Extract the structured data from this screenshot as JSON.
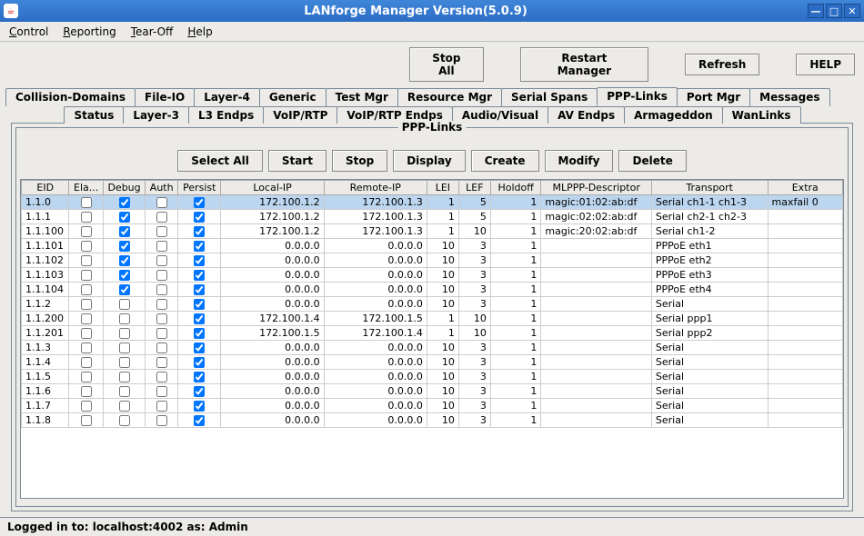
{
  "window": {
    "title": "LANforge Manager    Version(5.0.9)",
    "java_icon": "☕"
  },
  "menubar": [
    "Control",
    "Reporting",
    "Tear-Off",
    "Help"
  ],
  "toolbar": {
    "stop_all": "Stop All",
    "restart": "Restart Manager",
    "refresh": "Refresh",
    "help": "HELP"
  },
  "tabs_row1": [
    "Collision-Domains",
    "File-IO",
    "Layer-4",
    "Generic",
    "Test Mgr",
    "Resource Mgr",
    "Serial Spans",
    "PPP-Links",
    "Port Mgr",
    "Messages"
  ],
  "tabs_row2": [
    "Status",
    "Layer-3",
    "L3 Endps",
    "VoIP/RTP",
    "VoIP/RTP Endps",
    "Audio/Visual",
    "AV Endps",
    "Armageddon",
    "WanLinks"
  ],
  "active_tab": "PPP-Links",
  "panel": {
    "legend": "PPP-Links",
    "actions": {
      "select_all": "Select All",
      "start": "Start",
      "stop": "Stop",
      "display": "Display",
      "create": "Create",
      "modify": "Modify",
      "delete": "Delete"
    },
    "columns": [
      "EID",
      "Ela...",
      "Debug",
      "Auth",
      "Persist",
      "Local-IP",
      "Remote-IP",
      "LEI",
      "LEF",
      "Holdoff",
      "MLPPP-Descriptor",
      "Transport",
      "Extra"
    ],
    "rows": [
      {
        "eid": "1.1.0",
        "ela": false,
        "debug": true,
        "auth": false,
        "persist": true,
        "local": "172.100.1.2",
        "remote": "172.100.1.3",
        "lei": "1",
        "lef": "5",
        "hold": "1",
        "mlppp": "magic:01:02:ab:df",
        "trans": "Serial ch1-1 ch1-3",
        "extra": "maxfail 0",
        "selected": true
      },
      {
        "eid": "1.1.1",
        "ela": false,
        "debug": true,
        "auth": false,
        "persist": true,
        "local": "172.100.1.2",
        "remote": "172.100.1.3",
        "lei": "1",
        "lef": "5",
        "hold": "1",
        "mlppp": "magic:02:02:ab:df",
        "trans": "Serial ch2-1 ch2-3",
        "extra": ""
      },
      {
        "eid": "1.1.100",
        "ela": false,
        "debug": true,
        "auth": false,
        "persist": true,
        "local": "172.100.1.2",
        "remote": "172.100.1.3",
        "lei": "1",
        "lef": "10",
        "hold": "1",
        "mlppp": "magic:20:02:ab:df",
        "trans": "Serial ch1-2",
        "extra": ""
      },
      {
        "eid": "1.1.101",
        "ela": false,
        "debug": true,
        "auth": false,
        "persist": true,
        "local": "0.0.0.0",
        "remote": "0.0.0.0",
        "lei": "10",
        "lef": "3",
        "hold": "1",
        "mlppp": "",
        "trans": "PPPoE eth1",
        "extra": ""
      },
      {
        "eid": "1.1.102",
        "ela": false,
        "debug": true,
        "auth": false,
        "persist": true,
        "local": "0.0.0.0",
        "remote": "0.0.0.0",
        "lei": "10",
        "lef": "3",
        "hold": "1",
        "mlppp": "",
        "trans": "PPPoE eth2",
        "extra": ""
      },
      {
        "eid": "1.1.103",
        "ela": false,
        "debug": true,
        "auth": false,
        "persist": true,
        "local": "0.0.0.0",
        "remote": "0.0.0.0",
        "lei": "10",
        "lef": "3",
        "hold": "1",
        "mlppp": "",
        "trans": "PPPoE eth3",
        "extra": ""
      },
      {
        "eid": "1.1.104",
        "ela": false,
        "debug": true,
        "auth": false,
        "persist": true,
        "local": "0.0.0.0",
        "remote": "0.0.0.0",
        "lei": "10",
        "lef": "3",
        "hold": "1",
        "mlppp": "",
        "trans": "PPPoE eth4",
        "extra": ""
      },
      {
        "eid": "1.1.2",
        "ela": false,
        "debug": false,
        "auth": false,
        "persist": true,
        "local": "0.0.0.0",
        "remote": "0.0.0.0",
        "lei": "10",
        "lef": "3",
        "hold": "1",
        "mlppp": "",
        "trans": "Serial",
        "extra": ""
      },
      {
        "eid": "1.1.200",
        "ela": false,
        "debug": false,
        "auth": false,
        "persist": true,
        "local": "172.100.1.4",
        "remote": "172.100.1.5",
        "lei": "1",
        "lef": "10",
        "hold": "1",
        "mlppp": "",
        "trans": "Serial ppp1",
        "extra": ""
      },
      {
        "eid": "1.1.201",
        "ela": false,
        "debug": false,
        "auth": false,
        "persist": true,
        "local": "172.100.1.5",
        "remote": "172.100.1.4",
        "lei": "1",
        "lef": "10",
        "hold": "1",
        "mlppp": "",
        "trans": "Serial ppp2",
        "extra": ""
      },
      {
        "eid": "1.1.3",
        "ela": false,
        "debug": false,
        "auth": false,
        "persist": true,
        "local": "0.0.0.0",
        "remote": "0.0.0.0",
        "lei": "10",
        "lef": "3",
        "hold": "1",
        "mlppp": "",
        "trans": "Serial",
        "extra": ""
      },
      {
        "eid": "1.1.4",
        "ela": false,
        "debug": false,
        "auth": false,
        "persist": true,
        "local": "0.0.0.0",
        "remote": "0.0.0.0",
        "lei": "10",
        "lef": "3",
        "hold": "1",
        "mlppp": "",
        "trans": "Serial",
        "extra": ""
      },
      {
        "eid": "1.1.5",
        "ela": false,
        "debug": false,
        "auth": false,
        "persist": true,
        "local": "0.0.0.0",
        "remote": "0.0.0.0",
        "lei": "10",
        "lef": "3",
        "hold": "1",
        "mlppp": "",
        "trans": "Serial",
        "extra": ""
      },
      {
        "eid": "1.1.6",
        "ela": false,
        "debug": false,
        "auth": false,
        "persist": true,
        "local": "0.0.0.0",
        "remote": "0.0.0.0",
        "lei": "10",
        "lef": "3",
        "hold": "1",
        "mlppp": "",
        "trans": "Serial",
        "extra": ""
      },
      {
        "eid": "1.1.7",
        "ela": false,
        "debug": false,
        "auth": false,
        "persist": true,
        "local": "0.0.0.0",
        "remote": "0.0.0.0",
        "lei": "10",
        "lef": "3",
        "hold": "1",
        "mlppp": "",
        "trans": "Serial",
        "extra": ""
      },
      {
        "eid": "1.1.8",
        "ela": false,
        "debug": false,
        "auth": false,
        "persist": true,
        "local": "0.0.0.0",
        "remote": "0.0.0.0",
        "lei": "10",
        "lef": "3",
        "hold": "1",
        "mlppp": "",
        "trans": "Serial",
        "extra": ""
      }
    ]
  },
  "status": "Logged in to:  localhost:4002  as:  Admin"
}
